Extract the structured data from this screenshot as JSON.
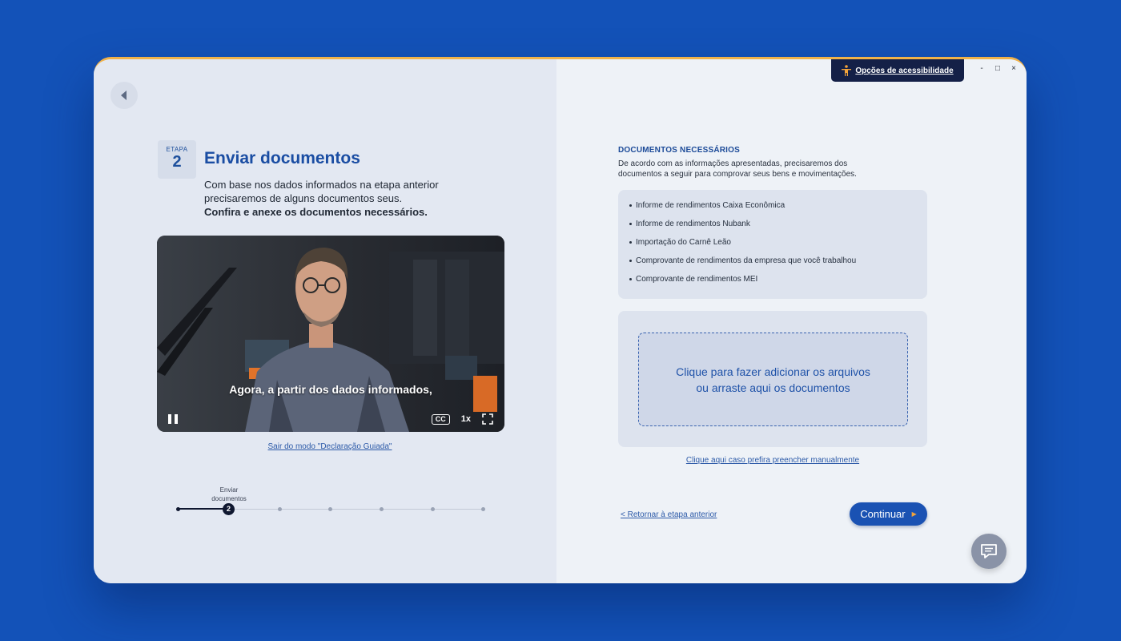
{
  "header": {
    "accessibility_label": "Opções de acessibilidade",
    "window_controls": {
      "minimize": "-",
      "maximize": "□",
      "close": "×"
    }
  },
  "step": {
    "label": "ETAPA",
    "number": "2",
    "title": "Enviar documentos",
    "description": "Com base nos dados informados na etapa anterior precisaremos de alguns documentos seus.",
    "emphasis": "Confira e anexe os documentos necessários."
  },
  "video": {
    "caption": "Agora, a partir dos dados informados,",
    "cc_label": "CC",
    "speed_label": "1x",
    "state": "playing"
  },
  "guided_mode_link": "Sair do modo \"Declaração Guiada\"",
  "stepper": {
    "current_step": "2",
    "current_label": "Enviar documentos",
    "total_steps": 7,
    "completed_steps": 1
  },
  "documents": {
    "heading": "DOCUMENTOS NECESSÁRIOS",
    "intro": "De acordo com as informações apresentadas, precisaremos dos documentos a seguir para comprovar seus bens e movimentações.",
    "items": [
      "Informe de rendimentos Caixa Econômica",
      "Informe de rendimentos Nubank",
      "Importação do Carnê Leão",
      "Comprovante de rendimentos da empresa que você trabalhou",
      "Comprovante de rendimentos MEI"
    ]
  },
  "upload": {
    "line1": "Clique para fazer adicionar os arquivos",
    "line2": "ou arraste aqui os documentos"
  },
  "manual_link": "Clique aqui caso prefira preencher manualmente",
  "footer": {
    "previous_link": "< Retornar à etapa anterior",
    "continue_label": "Continuar"
  },
  "colors": {
    "background": "#1352b8",
    "primary": "#1a52b3",
    "accent": "#f2a33a",
    "dark_navy": "#142047"
  }
}
